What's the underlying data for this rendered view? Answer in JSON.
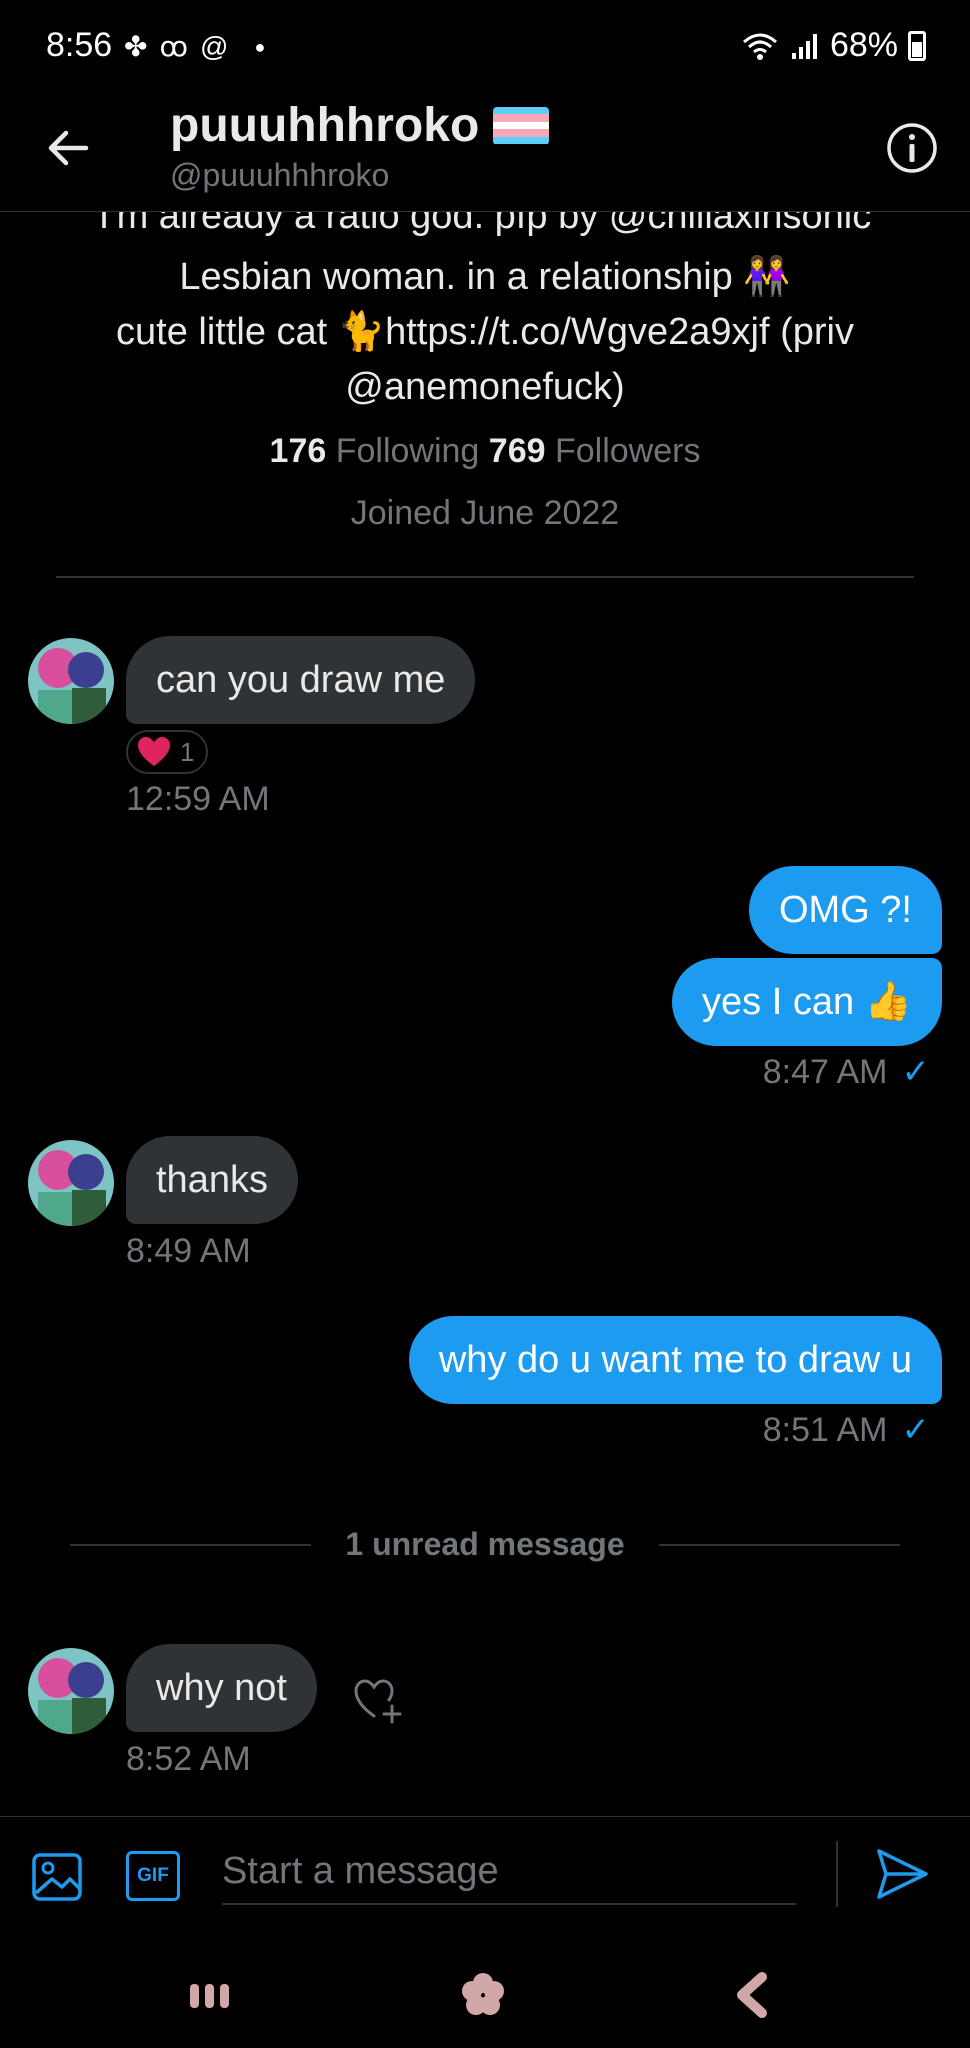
{
  "status_bar": {
    "time": "8:56",
    "battery": "68%"
  },
  "header": {
    "title": "puuuhhhroko",
    "handle": "@puuuhhhroko",
    "flag_colors": [
      "#5bcefa",
      "#f5a9b8",
      "#ffffff",
      "#f5a9b8",
      "#5bcefa"
    ]
  },
  "profile": {
    "bio_line_1": "I'm already a ratio god. pfp by @chillaxinsonic",
    "bio_line_2": "Lesbian woman. in a relationship 👭",
    "bio_line_3": "cute little cat 🐈https://t.co/Wgve2a9xjf (priv",
    "bio_line_4": "@anemonefuck)",
    "following_count": "176",
    "following_label": "Following",
    "followers_count": "769",
    "followers_label": "Followers",
    "joined": "Joined June 2022"
  },
  "messages": {
    "m1_text": "can you draw me",
    "m1_reaction_count": "1",
    "m1_time": "12:59 AM",
    "m2_text": "OMG ?!",
    "m3_text": "yes I can 👍",
    "m3_time": "8:47 AM",
    "m4_text": "thanks",
    "m4_time": "8:49 AM",
    "m5_text": "why do u want me to draw u",
    "m5_time": "8:51 AM",
    "unread_label": "1 unread message",
    "m6_text": "why not",
    "m6_time": "8:52 AM",
    "check_mark": "✓"
  },
  "composer": {
    "gif_label": "GIF",
    "placeholder": "Start a message"
  },
  "colors": {
    "accent": "#1d9bf0",
    "incoming_bubble": "#2f3336",
    "muted_text": "#71767b"
  }
}
